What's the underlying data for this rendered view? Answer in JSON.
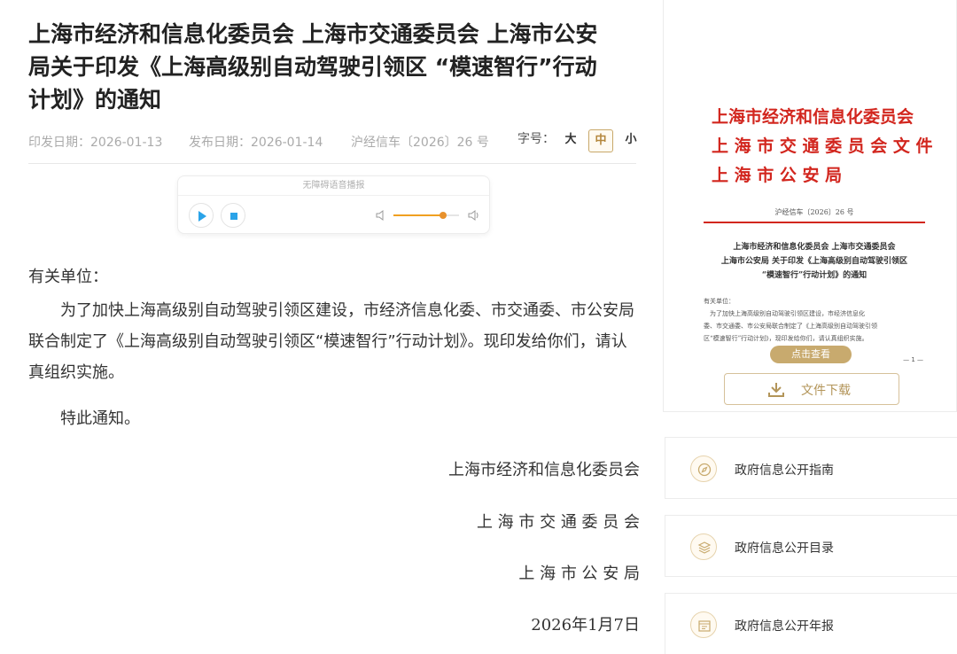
{
  "article": {
    "title": "上海市经济和信息化委员会 上海市交通委员会 上海市公安局关于印发《上海高级别自动驾驶引领区 “模速智行”行动计划》的通知",
    "print_date": "印发日期：2026-01-13",
    "publish_date": "发布日期：2026-01-14",
    "doc_number": "沪经信车〔2026〕26 号",
    "font_size_label": "字号：",
    "font_sizes": [
      "大",
      "中",
      "小"
    ],
    "font_size_selected": "中",
    "audio_caption": "无障碍语音播报",
    "volume": 0.75,
    "greeting": "有关单位：",
    "paragraph": "为了加快上海高级别自动驾驶引领区建设，市经济信息化委、市交通委、市公安局联合制定了《上海高级别自动驾驶引领区“模速智行”行动计划》。现印发给你们，请认真组织实施。",
    "closing": "特此通知。",
    "signatures": [
      "上海市经济和信息化委员会",
      "上 海 市 交 通 委 员 会",
      "上 海 市 公 安 局"
    ],
    "sign_date": "2026年1月7日"
  },
  "doc_preview": {
    "header_lines": [
      "上海市经济和信息化委员会",
      "上 海 市 交 通 委 员 会  文 件",
      "上 海 市 公 安 局"
    ],
    "number": "沪经信车〔2026〕26 号",
    "title_lines": [
      "上海市经济和信息化委员会 上海市交通委员会",
      "上海市公安局 关于印发《上海高级别自动驾驶引领区",
      "“模速智行”行动计划》的通知"
    ],
    "body_lines": [
      "有关单位：",
      "　为了加快上海高级别自动驾驶引领区建设，市经济信息化",
      "委、市交通委、市公安局联合制定了《上海高级别自动驾驶引领",
      "区“模速智行”行动计划》，现印发给你们，请认真组织实施。"
    ],
    "page_no": "— 1 —",
    "view_label": "点击查看",
    "download_label": "文件下载"
  },
  "sidebar": {
    "items": [
      {
        "label": "政府信息公开指南",
        "icon": "compass-icon"
      },
      {
        "label": "政府信息公开目录",
        "icon": "layers-icon"
      },
      {
        "label": "政府信息公开年报",
        "icon": "calendar-report-icon"
      }
    ]
  },
  "colors": {
    "accent_gold": "#c8aa6e",
    "red_header": "#d2261e",
    "volume_orange": "#f0a020",
    "play_blue": "#2aa3e8"
  }
}
